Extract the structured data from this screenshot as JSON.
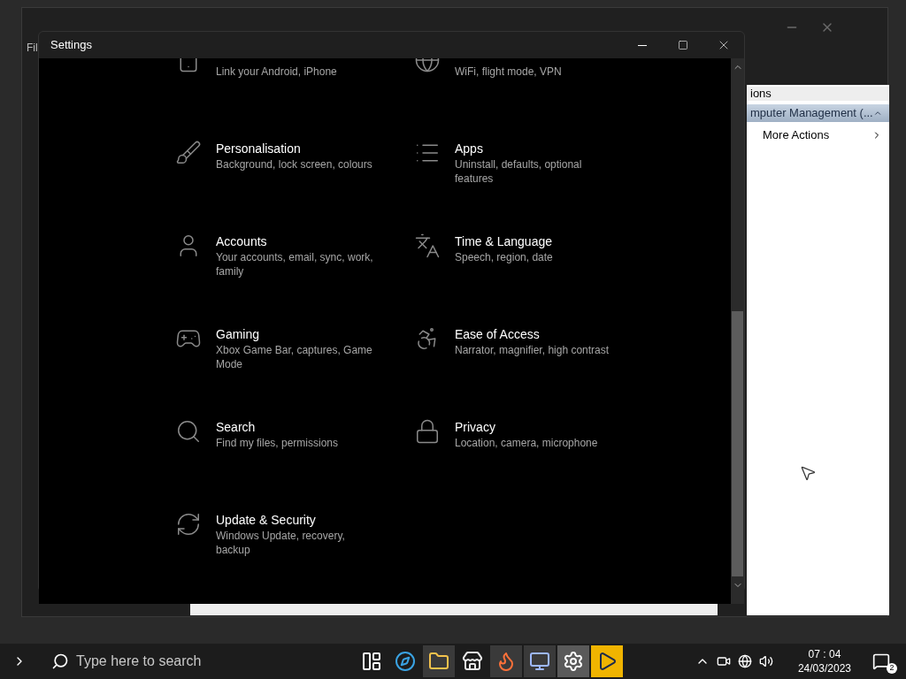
{
  "background_window": {
    "menu_fragment": "Fil",
    "actions_header": "ions",
    "actions_group": "mputer Management (...",
    "actions_item": "More Actions"
  },
  "settings": {
    "title": "Settings",
    "categories": [
      {
        "description": "Link your Android, iPhone"
      },
      {
        "description": "WiFi, flight mode, VPN"
      },
      {
        "title": "Personalisation",
        "description": "Background, lock screen, colours"
      },
      {
        "title": "Apps",
        "description": "Uninstall, defaults, optional features"
      },
      {
        "title": "Accounts",
        "description": "Your accounts, email, sync, work, family"
      },
      {
        "title": "Time & Language",
        "description": "Speech, region, date"
      },
      {
        "title": "Gaming",
        "description": "Xbox Game Bar, captures, Game Mode"
      },
      {
        "title": "Ease of Access",
        "description": "Narrator, magnifier, high contrast"
      },
      {
        "title": "Search",
        "description": "Find my files, permissions"
      },
      {
        "title": "Privacy",
        "description": "Location, camera, microphone"
      },
      {
        "title": "Update & Security",
        "description": "Windows Update, recovery, backup"
      }
    ]
  },
  "taskbar": {
    "search": {
      "placeholder": "Type here to search"
    },
    "apps": [
      {
        "running": false,
        "selected": false
      },
      {
        "running": false,
        "selected": false
      },
      {
        "running": true,
        "selected": false
      },
      {
        "running": false,
        "selected": false
      },
      {
        "running": true,
        "selected": false
      },
      {
        "running": true,
        "selected": false
      },
      {
        "running": true,
        "selected": true
      },
      {
        "running": false,
        "selected": false
      }
    ],
    "time": "07 : 04",
    "date": "24/03/2023",
    "notifications": "2"
  }
}
